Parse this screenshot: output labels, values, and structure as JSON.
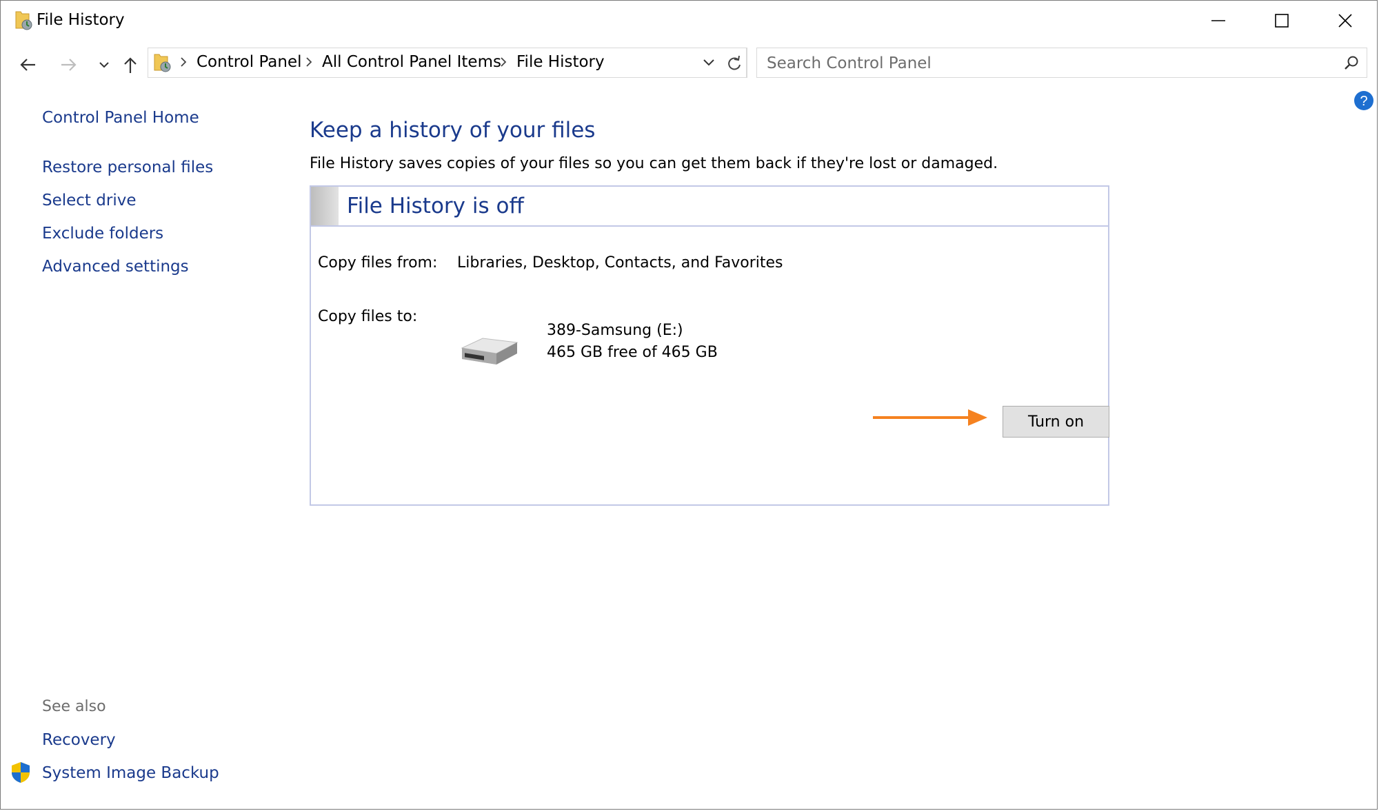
{
  "window": {
    "title": "File History",
    "controls": {
      "minimize": "minimize",
      "maximize": "maximize",
      "close": "close"
    }
  },
  "navigation": {
    "breadcrumb": [
      "Control Panel",
      "All Control Panel Items",
      "File History"
    ],
    "search_placeholder": "Search Control Panel"
  },
  "sidebar": {
    "home_link": "Control Panel Home",
    "links": [
      "Restore personal files",
      "Select drive",
      "Exclude folders",
      "Advanced settings"
    ],
    "see_also_heading": "See also",
    "see_also_links": [
      "Recovery",
      "System Image Backup"
    ]
  },
  "main": {
    "heading": "Keep a history of your files",
    "description": "File History saves copies of your files so you can get them back if they're lost or damaged.",
    "status_title": "File History is off",
    "copy_from_label": "Copy files from:",
    "copy_from_value": "Libraries, Desktop, Contacts, and Favorites",
    "copy_to_label": "Copy files to:",
    "drive_name": "389-Samsung (E:)",
    "drive_space": "465 GB free of 465 GB",
    "turn_on_label": "Turn on"
  },
  "colors": {
    "link": "#1a3a8c",
    "heading": "#1a3a8c",
    "box_border": "#c2c8e6",
    "button_bg": "#e1e1e1",
    "annotation_arrow": "#f58220"
  },
  "icons": [
    "file-history-icon",
    "control-panel-icon",
    "back-arrow-icon",
    "forward-arrow-icon",
    "recent-locations-icon",
    "up-arrow-icon",
    "refresh-icon",
    "search-icon",
    "help-icon",
    "shield-icon",
    "hard-drive-icon"
  ]
}
